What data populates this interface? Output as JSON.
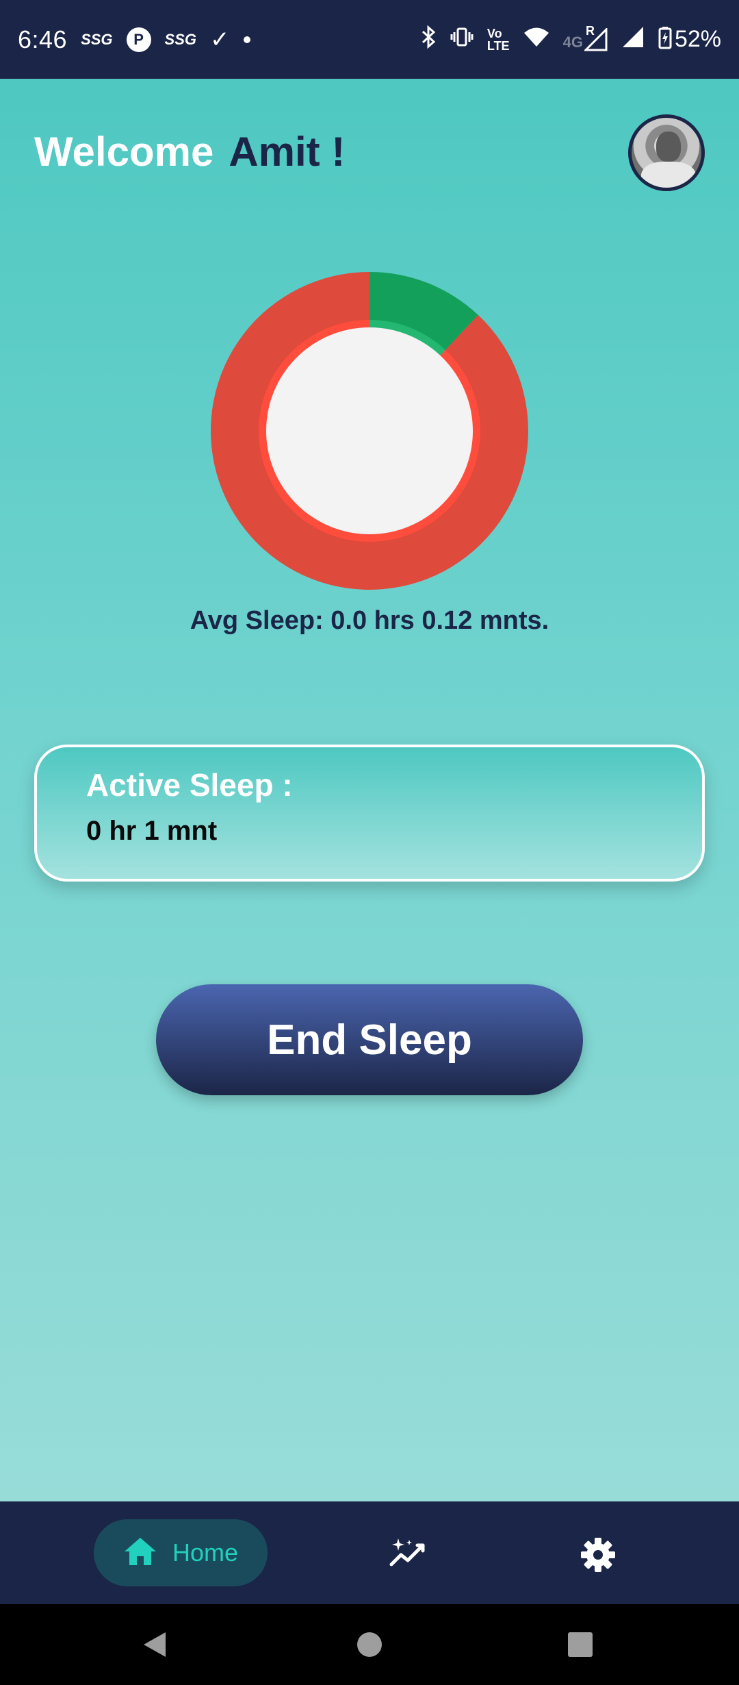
{
  "status_bar": {
    "time": "6:46",
    "ssg1": "SSG",
    "ssg2": "SSG",
    "circle_label": "P",
    "lte_top": "Vo",
    "lte_bottom": "LTE",
    "network": "4G",
    "roaming": "R",
    "battery": "52%"
  },
  "header": {
    "welcome": "Welcome",
    "name": "Amit !"
  },
  "chart_data": {
    "type": "pie",
    "title": "",
    "slices": [
      {
        "value": 0.12,
        "color": "#12a05a"
      },
      {
        "value": 0.88,
        "color": "#de4a3c"
      }
    ],
    "inner_ring_colors": [
      "#23b772",
      "#ff4d3d"
    ],
    "center_color": "#f3f3f3"
  },
  "avg_sleep": "Avg Sleep: 0.0 hrs 0.12 mnts.",
  "active_sleep": {
    "title": "Active Sleep :",
    "value": "0 hr  1 mnt"
  },
  "end_button": "End Sleep",
  "bottom_nav": {
    "home_label": "Home",
    "active_color": "#21d0bd"
  },
  "colors": {
    "navy": "#1b2547",
    "teal_top": "#4ec8c1",
    "teal_bottom": "#98dcd8"
  }
}
